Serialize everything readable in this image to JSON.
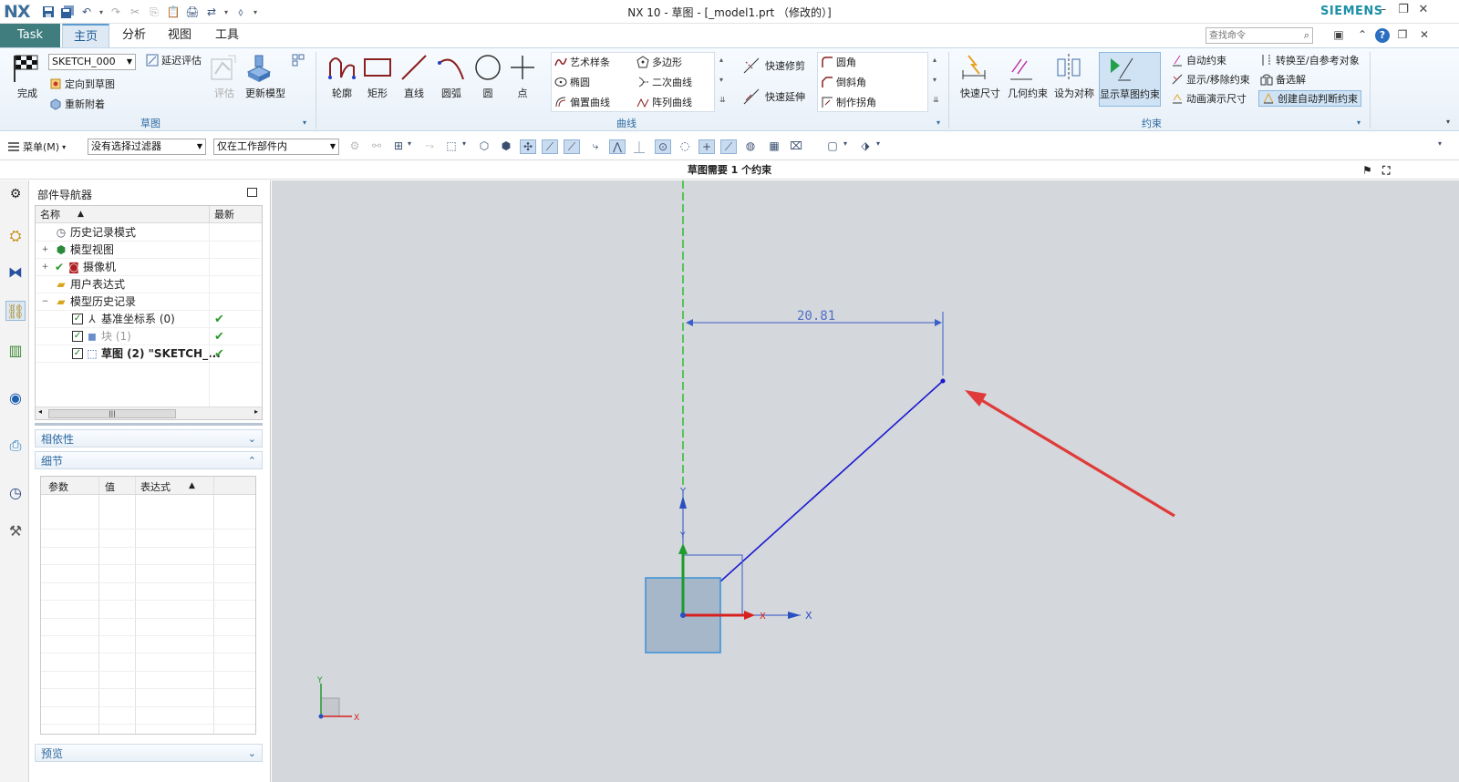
{
  "app": {
    "logo": "NX",
    "window_title": "NX 10 - 草图 - [_model1.prt （修改的）]",
    "brand": "SIEMENS"
  },
  "tabs": [
    {
      "label": "Task"
    },
    {
      "label": "主页"
    },
    {
      "label": "分析"
    },
    {
      "label": "视图"
    },
    {
      "label": "工具"
    }
  ],
  "search": {
    "placeholder": "查找命令"
  },
  "ribbon": {
    "sketch_group": {
      "label": "草图",
      "finish": "完成",
      "sketch_name": "SKETCH_000",
      "delay_eval": "延迟评估",
      "orient_view": "定向到草图",
      "reattach": "重新附着",
      "evaluate": "评估",
      "update_model": "更新模型"
    },
    "curve_group": {
      "label": "曲线",
      "profile": "轮廓",
      "rectangle": "矩形",
      "line": "直线",
      "arc": "圆弧",
      "circle": "圆",
      "point": "点",
      "studio_spline": "艺术样条",
      "polygon": "多边形",
      "ellipse": "椭圆",
      "conic": "二次曲线",
      "offset_curve": "偏置曲线",
      "pattern_curve": "阵列曲线",
      "quick_trim": "快速修剪",
      "quick_extend": "快速延伸",
      "fillet": "圆角",
      "chamfer": "倒斜角",
      "make_corner": "制作拐角"
    },
    "constraint_group": {
      "label": "约束",
      "rapid_dimension": "快速尺寸",
      "geometric_constraint": "几何约束",
      "make_symmetric": "设为对称",
      "show_sketch_constraints": "显示草图约束",
      "auto_constrain": "自动约束",
      "show_remove_constraints": "显示/移除约束",
      "animate_dimension": "动画演示尺寸",
      "convert_reference": "转换至/自参考对象",
      "alternate_solution": "备选解",
      "create_inferred_constraints": "创建自动判断约束"
    }
  },
  "toolbar2": {
    "menu": "菜单(M)",
    "filter": "没有选择过滤器",
    "scope": "仅在工作部件内"
  },
  "status": {
    "message": "草图需要 1 个约束"
  },
  "navigator": {
    "title": "部件导航器",
    "col_name": "名称",
    "col_latest": "最新",
    "rows": [
      {
        "label": "历史记录模式"
      },
      {
        "label": "模型视图"
      },
      {
        "label": "摄像机"
      },
      {
        "label": "用户表达式"
      },
      {
        "label": "模型历史记录"
      },
      {
        "label": "基准坐标系 (0)"
      },
      {
        "label": "块 (1)"
      },
      {
        "label": "草图 (2) \"SKETCH_..."
      }
    ],
    "dependencies": "相依性",
    "details": "细节",
    "detail_cols": [
      "参数",
      "值",
      "表达式"
    ],
    "preview": "预览"
  },
  "canvas": {
    "dimension_value": "20.81",
    "axis_x": "X",
    "axis_y": "Y",
    "colors": {
      "background": "#d4d7db",
      "sketch_line": "#1818d0",
      "dimension": "#3a5fc8",
      "arrow": "#e03a3a",
      "axis_x": "#d82020",
      "axis_y": "#1e9a2e",
      "datum": "#22bb22"
    }
  }
}
